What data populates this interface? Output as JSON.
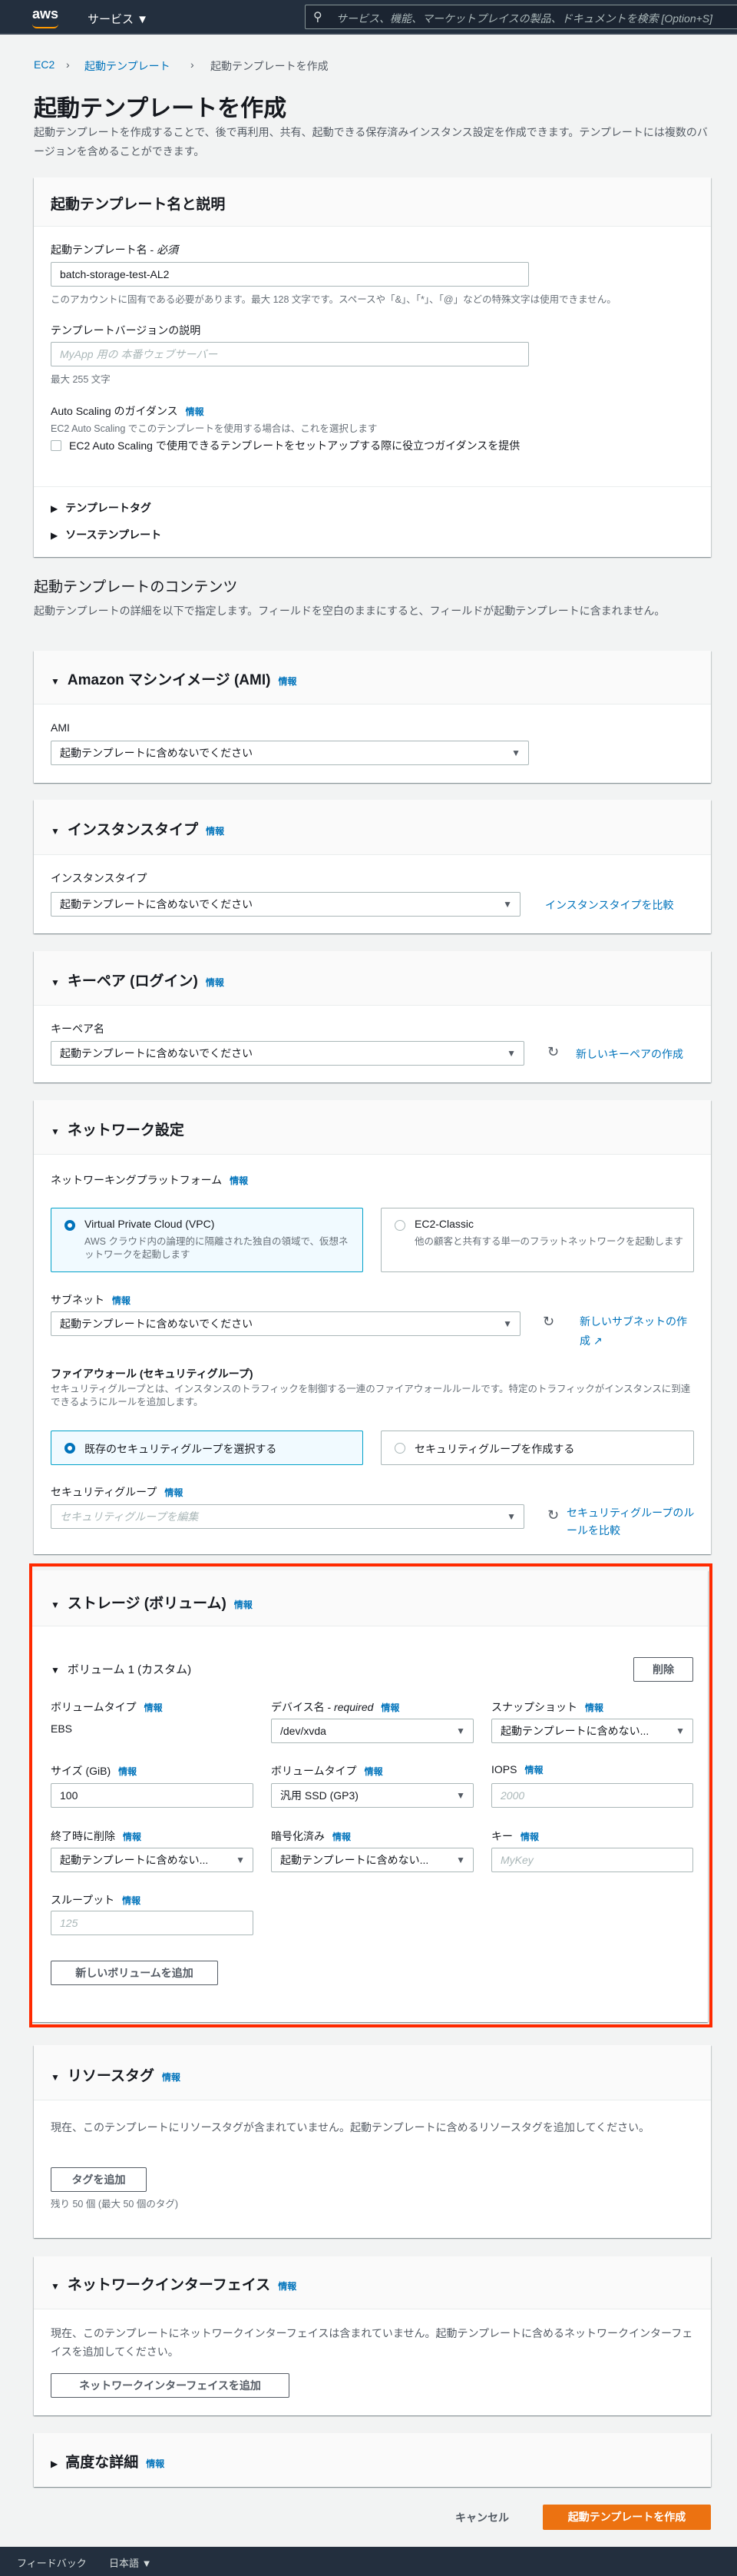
{
  "topbar": {
    "logo": "aws",
    "services": "サービス ▼",
    "search_placeholder": "サービス、機能、マーケットプレイスの製品、ドキュメントを検索 [Option+S]"
  },
  "breadcrumb": [
    "EC2",
    "起動テンプレート",
    "起動テンプレートを作成"
  ],
  "page": {
    "title": "起動テンプレートを作成",
    "description": "起動テンプレートを作成することで、後で再利用、共有、起動できる保存済みインスタンス設定を作成できます。テンプレートには複数のバージョンを含めることができます。"
  },
  "info": "情報",
  "name_card": {
    "title": "起動テンプレート名と説明",
    "name_label": "起動テンプレート名 - ",
    "name_required": "必須",
    "name_value": "batch-storage-test-AL2",
    "name_hint": "このアカウントに固有である必要があります。最大 128 文字です。スペースや「&」、「*」、「@」などの特殊文字は使用できません。",
    "version_label": "テンプレートバージョンの説明",
    "version_placeholder": "MyApp 用の 本番ウェブサーバー",
    "version_hint": "最大 255 文字",
    "as_label": "Auto Scaling のガイダンス",
    "as_desc": "EC2 Auto Scaling でこのテンプレートを使用する場合は、これを選択します",
    "as_checkbox": "EC2 Auto Scaling で使用できるテンプレートをセットアップする際に役立つガイダンスを提供",
    "tags": "テンプレートタグ",
    "source": "ソーステンプレート"
  },
  "contents": {
    "title": "起動テンプレートのコンテンツ",
    "description": "起動テンプレートの詳細を以下で指定します。フィールドを空白のままにすると、フィールドが起動テンプレートに含まれません。"
  },
  "dont_include": "起動テンプレートに含めないでください",
  "dont_include_short": "起動テンプレートに含めない...",
  "ami": {
    "title": "Amazon マシンイメージ (AMI)",
    "label": "AMI"
  },
  "instance": {
    "title": "インスタンスタイプ",
    "label": "インスタンスタイプ",
    "compare": "インスタンスタイプを比較"
  },
  "keypair": {
    "title": "キーペア (ログイン)",
    "label": "キーペア名",
    "create": "新しいキーペアの作成"
  },
  "network": {
    "title": "ネットワーク設定",
    "platform_label": "ネットワーキングプラットフォーム",
    "vpc_title": "Virtual Private Cloud (VPC)",
    "vpc_desc": "AWS クラウド内の論理的に隔離された独自の領域で、仮想ネットワークを起動します",
    "classic_title": "EC2-Classic",
    "classic_desc": "他の顧客と共有する単一のフラットネットワークを起動します",
    "subnet_label": "サブネット",
    "subnet_create": "新しいサブネットの作成",
    "firewall_title": "ファイアウォール (セキュリティグループ)",
    "firewall_desc": "セキュリティグループとは、インスタンスのトラフィックを制御する一連のファイアウォールルールです。特定のトラフィックがインスタンスに到達できるようにルールを追加します。",
    "sg_existing": "既存のセキュリティグループを選択する",
    "sg_create": "セキュリティグループを作成する",
    "sg_label": "セキュリティグループ",
    "sg_placeholder": "セキュリティグループを編集",
    "sg_compare": "セキュリティグループのルールを比較"
  },
  "storage": {
    "title": "ストレージ (ボリューム)",
    "volume_title": "ボリューム 1 (カスタム)",
    "delete": "削除",
    "vol_type_label": "ボリュームタイプ",
    "vol_type_value": "EBS",
    "device_label": "デバイス名 - ",
    "device_required": "required",
    "device_value": "/dev/xvda",
    "snapshot_label": "スナップショット",
    "size_label": "サイズ (GiB)",
    "size_value": "100",
    "ebs_type_label": "ボリュームタイプ",
    "ebs_type_value": "汎用 SSD (GP3)",
    "iops_label": "IOPS",
    "iops_placeholder": "2000",
    "delete_on_term_label": "終了時に削除",
    "encrypted_label": "暗号化済み",
    "key_label": "キー",
    "key_placeholder": "MyKey",
    "throughput_label": "スループット",
    "throughput_placeholder": "125",
    "add_volume": "新しいボリュームを追加"
  },
  "resource_tags": {
    "title": "リソースタグ",
    "desc": "現在、このテンプレートにリソースタグが含まれていません。起動テンプレートに含めるリソースタグを追加してください。",
    "add": "タグを追加",
    "hint": "残り 50 個 (最大 50 個のタグ)"
  },
  "nic": {
    "title": "ネットワークインターフェイス",
    "desc": "現在、このテンプレートにネットワークインターフェイスは含まれていません。起動テンプレートに含めるネットワークインターフェイスを追加してください。",
    "add": "ネットワークインターフェイスを追加"
  },
  "advanced": {
    "title": "高度な詳細"
  },
  "actions": {
    "cancel": "キャンセル",
    "create": "起動テンプレートを作成"
  },
  "footer": {
    "feedback": "フィードバック",
    "language": "日本語 ▼"
  },
  "colors": {
    "link": "#0073bb",
    "primary": "#ec7211",
    "highlight": "#ff2a00",
    "topbar": "#232f3e"
  }
}
